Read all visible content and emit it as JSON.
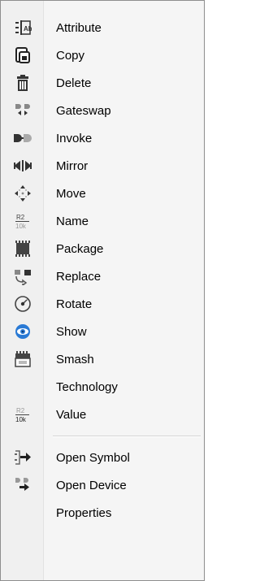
{
  "menu": {
    "items": [
      {
        "label": "Attribute",
        "icon": "attribute-icon"
      },
      {
        "label": "Copy",
        "icon": "copy-icon"
      },
      {
        "label": "Delete",
        "icon": "delete-icon"
      },
      {
        "label": "Gateswap",
        "icon": "gateswap-icon"
      },
      {
        "label": "Invoke",
        "icon": "invoke-icon"
      },
      {
        "label": "Mirror",
        "icon": "mirror-icon"
      },
      {
        "label": "Move",
        "icon": "move-icon"
      },
      {
        "label": "Name",
        "icon": "name-icon",
        "icon_text_top": "R2",
        "icon_text_bottom": "10k"
      },
      {
        "label": "Package",
        "icon": "package-icon"
      },
      {
        "label": "Replace",
        "icon": "replace-icon"
      },
      {
        "label": "Rotate",
        "icon": "rotate-icon"
      },
      {
        "label": "Show",
        "icon": "show-icon"
      },
      {
        "label": "Smash",
        "icon": "smash-icon"
      },
      {
        "label": "Technology",
        "icon": null
      },
      {
        "label": "Value",
        "icon": "value-icon",
        "icon_text_top": "R2",
        "icon_text_bottom": "10k"
      }
    ],
    "extra_items": [
      {
        "label": "Open Symbol",
        "icon": "open-symbol-icon"
      },
      {
        "label": "Open Device",
        "icon": "open-device-icon"
      },
      {
        "label": "Properties",
        "icon": null
      }
    ]
  },
  "colors": {
    "menu_background": "#f5f5f5",
    "icon_gutter": "#f0f0f0",
    "border": "#8e8e8e",
    "icon_dark": "#333333",
    "icon_blue": "#2a7ad5"
  }
}
